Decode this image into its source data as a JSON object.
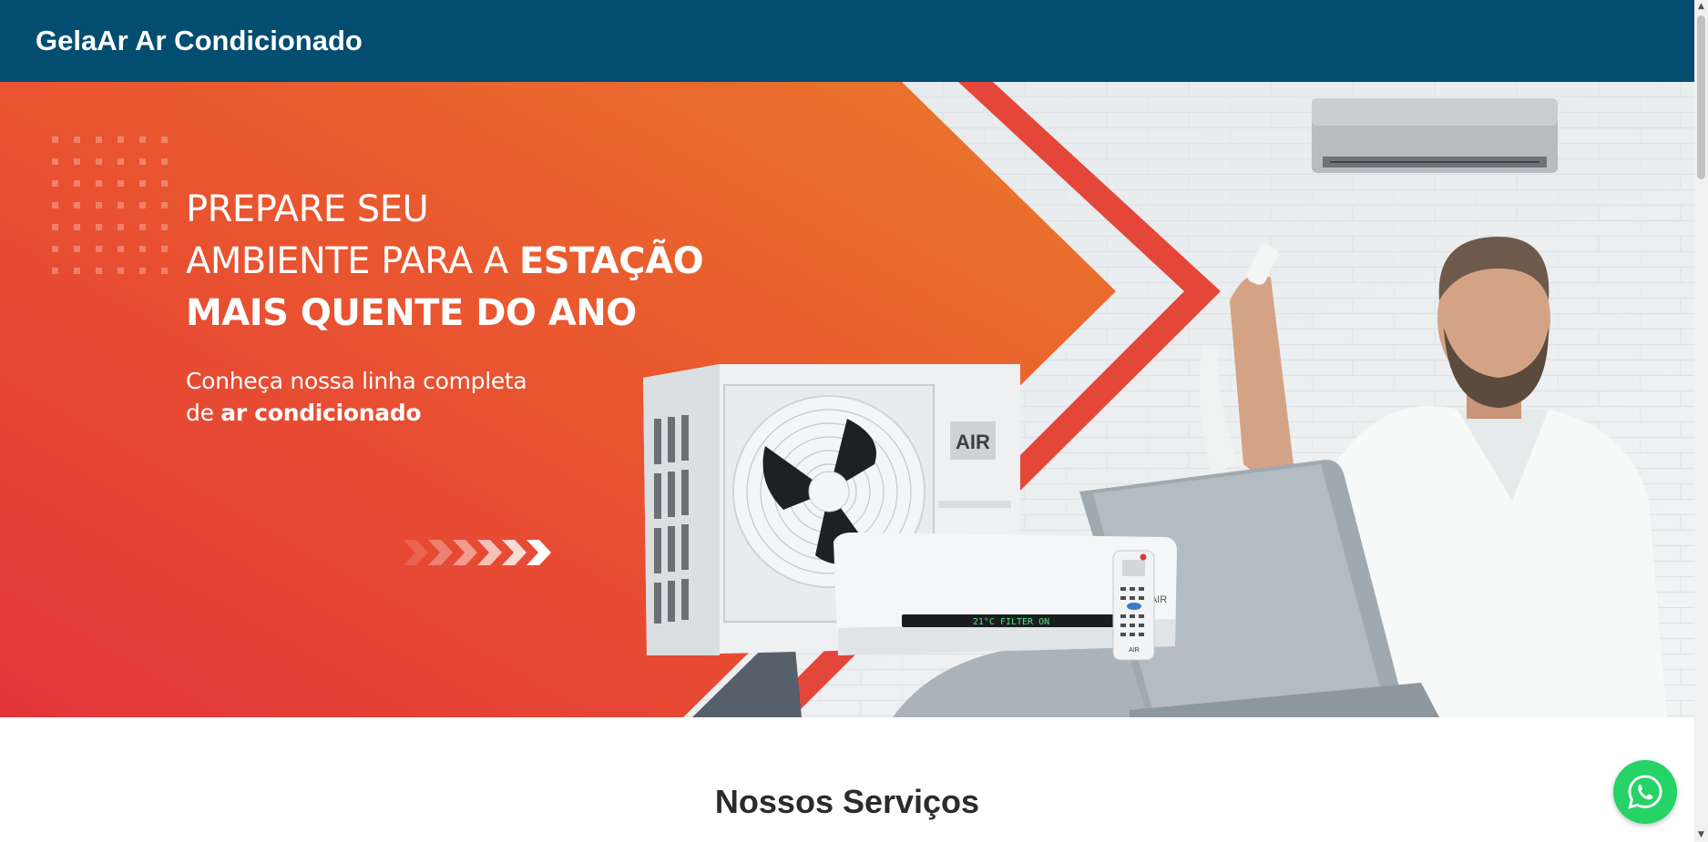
{
  "header": {
    "title": "GelaAr Ar Condicionado",
    "background": "#024d70"
  },
  "hero": {
    "headline_line1": "PREPARE SEU",
    "headline_line2_regular": "AMBIENTE PARA A ",
    "headline_line2_bold": "ESTAÇÃO",
    "headline_line3": "MAIS QUENTE DO ANO",
    "subtitle_line1": "Conheça nossa linha completa",
    "subtitle_line2_regular": "de ",
    "subtitle_line2_bold": "ar condicionado",
    "unit_label_outdoor": "AIR",
    "unit_label_indoor": "AIR",
    "display_text": "21°C  FILTER ON",
    "remote_label": "AIR",
    "gradient_start": "#e3353a",
    "gradient_end": "#ea7a2c"
  },
  "services": {
    "title": "Nossos Serviços"
  },
  "whatsapp": {
    "icon": "whatsapp-icon",
    "color": "#25d366"
  },
  "scrollbar": {
    "up": "▲",
    "down": "▼"
  }
}
